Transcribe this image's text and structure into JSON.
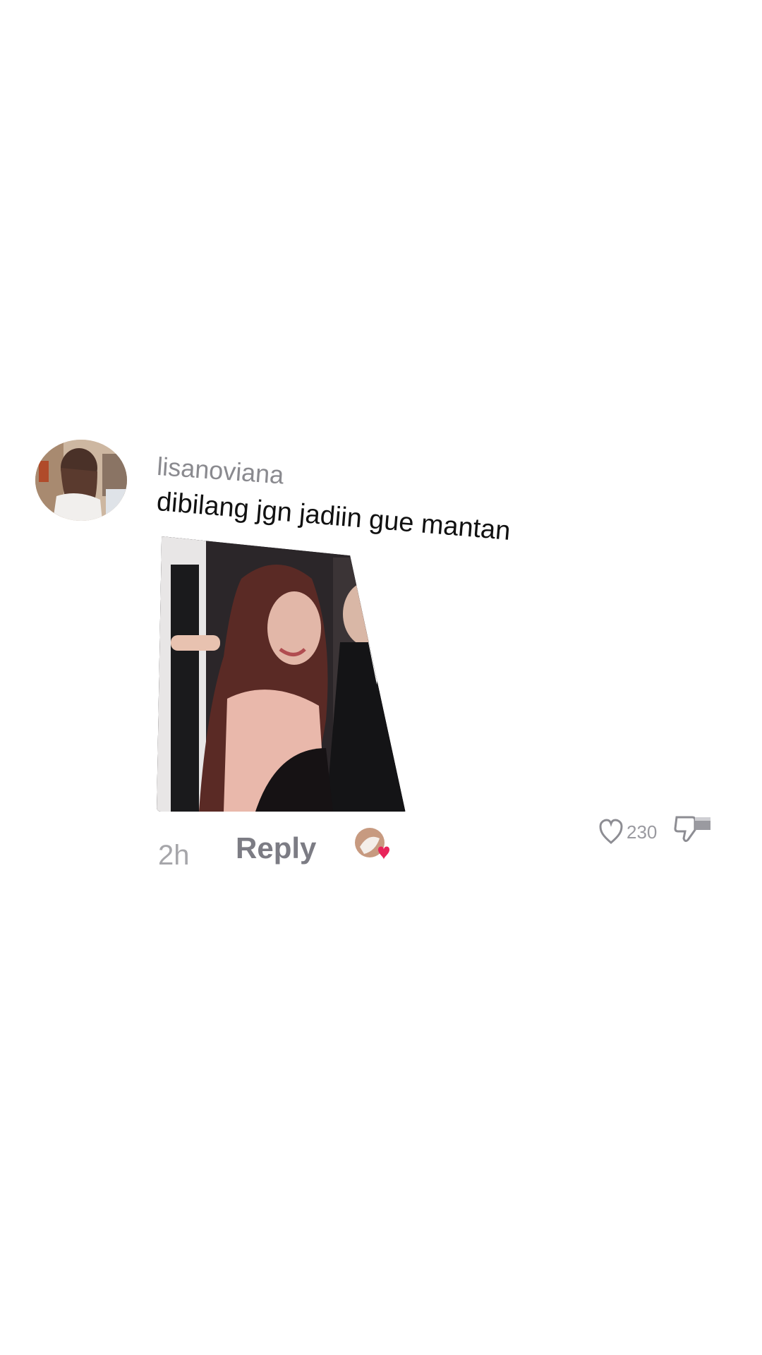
{
  "comment": {
    "username": "lisanoviana",
    "text": "dibilang jgn jadiin gue mantan",
    "time": "2h",
    "reply_label": "Reply",
    "likes": "230"
  },
  "icons": {
    "like": "heart-outline-icon",
    "dislike": "thumbs-down-icon",
    "liked_by_creator": "heart-filled-icon"
  },
  "colors": {
    "heart_badge": "#e8245a",
    "meta_text": "#8a8a8f"
  }
}
